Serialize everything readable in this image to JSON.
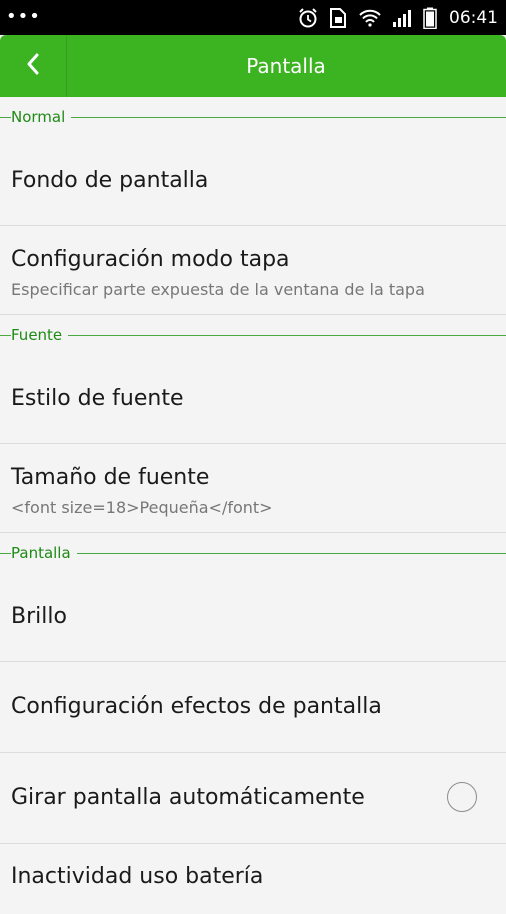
{
  "status_bar": {
    "dots": "•••",
    "time": "06:41",
    "icons": [
      "alarm-icon",
      "sim-icon",
      "wifi-icon",
      "signal-icon",
      "battery-icon"
    ]
  },
  "header": {
    "title": "Pantalla",
    "back_icon": "chevron-left-icon"
  },
  "colors": {
    "accent": "#3cb321",
    "section_text": "#1f8a16"
  },
  "sections": [
    {
      "label": "Normal",
      "items": [
        {
          "title": "Fondo de pantalla"
        },
        {
          "title": "Configuración modo tapa",
          "subtitle": "Especificar parte expuesta de la ventana de la tapa"
        }
      ]
    },
    {
      "label": "Fuente",
      "items": [
        {
          "title": "Estilo de fuente"
        },
        {
          "title": "Tamaño de fuente",
          "subtitle": "<font size=18>Pequeña</font>"
        }
      ]
    },
    {
      "label": "Pantalla",
      "items": [
        {
          "title": "Brillo"
        },
        {
          "title": "Configuración efectos de pantalla"
        },
        {
          "title": "Girar pantalla automáticamente",
          "checked": false
        },
        {
          "title": "Inactividad uso batería"
        }
      ]
    }
  ]
}
